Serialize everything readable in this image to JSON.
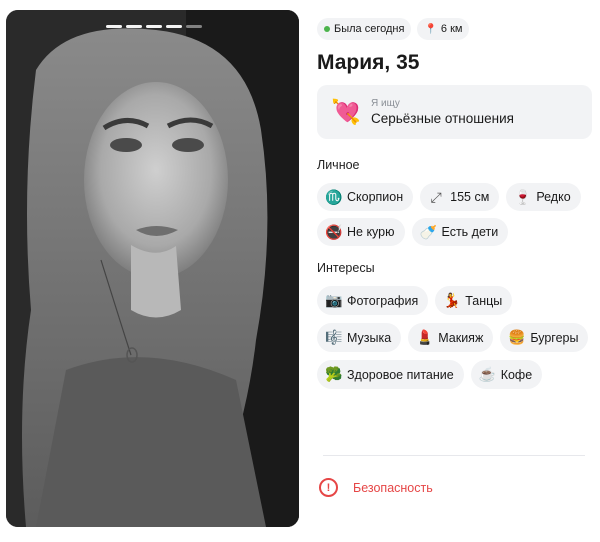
{
  "photo": {
    "alt_icon": "profile-photo",
    "stories_total": 5,
    "stories_active": 4
  },
  "status": {
    "online": "Была сегодня",
    "distance": "6 км",
    "online_color": "#4bb34b"
  },
  "profile": {
    "name": "Мария, 35"
  },
  "seeking": {
    "label": "Я ищу",
    "value": "Серьёзные отношения",
    "icon": "heart-arrow-icon"
  },
  "personal": {
    "title": "Личное",
    "items": [
      {
        "icon": "scorpio-icon",
        "glyph": "♏",
        "label": "Скорпион"
      },
      {
        "icon": "height-icon",
        "glyph": "⤢",
        "label": "155 см"
      },
      {
        "icon": "wine-glass-icon",
        "glyph": "🍷",
        "label": "Редко"
      },
      {
        "icon": "no-smoking-icon",
        "glyph": "🚭",
        "label": "Не курю"
      },
      {
        "icon": "baby-bottle-icon",
        "glyph": "🍼",
        "label": "Есть дети"
      }
    ]
  },
  "interests": {
    "title": "Интересы",
    "items": [
      {
        "icon": "camera-icon",
        "glyph": "📷",
        "label": "Фотография"
      },
      {
        "icon": "dancer-icon",
        "glyph": "💃",
        "label": "Танцы"
      },
      {
        "icon": "music-score-icon",
        "glyph": "🎼",
        "label": "Музыка"
      },
      {
        "icon": "lipstick-icon",
        "glyph": "💄",
        "label": "Макияж"
      },
      {
        "icon": "burger-icon",
        "glyph": "🍔",
        "label": "Бургеры"
      },
      {
        "icon": "broccoli-icon",
        "glyph": "🥦",
        "label": "Здоровое питание"
      },
      {
        "icon": "coffee-icon",
        "glyph": "☕",
        "label": "Кофе"
      }
    ]
  },
  "safety": {
    "label": "Безопасность",
    "color": "#e64646"
  }
}
